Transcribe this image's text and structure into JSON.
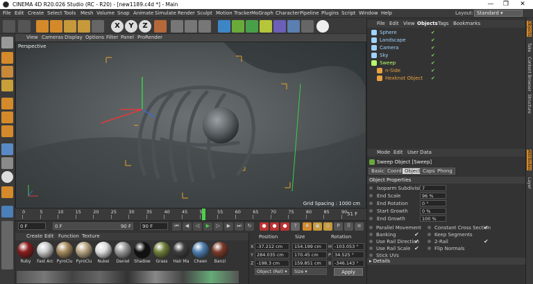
{
  "window": {
    "title": "CINEMA 4D R20.026 Studio (RC - R20) - [new1189.c4d *] - Main",
    "minimize": "—",
    "maximize": "❐",
    "close": "✕"
  },
  "menubar": {
    "items": [
      "File",
      "Edit",
      "Create",
      "Select",
      "Tools",
      "Mesh",
      "Volume",
      "Snap",
      "Animate",
      "Simulate",
      "Render",
      "Sculpt",
      "Motion Tracker",
      "MoGraph",
      "Character",
      "Pipeline",
      "Plugins",
      "Script",
      "Window",
      "Help"
    ],
    "layout_label": "Layout:",
    "layout_value": "Standard"
  },
  "toolbar": {
    "axis_x": "X",
    "axis_y": "Y",
    "axis_z": "Z"
  },
  "viewport": {
    "menu": [
      "View",
      "Cameras",
      "Display",
      "Options",
      "Filter",
      "Panel",
      "ProRender"
    ],
    "label": "Perspective",
    "grid_spacing": "Grid Spacing : 1000 cm"
  },
  "timeline": {
    "ticks": [
      "0",
      "5",
      "10",
      "15",
      "20",
      "25",
      "30",
      "35",
      "40",
      "45",
      "50",
      "55",
      "60",
      "65",
      "70",
      "75",
      "80",
      "85",
      "90"
    ],
    "current_frame": "51 F",
    "playhead_value": 51
  },
  "playback": {
    "start": "0 F",
    "min": "0 F",
    "max": "90 F",
    "end": "90 F"
  },
  "materials": {
    "menu": [
      "Create",
      "Edit",
      "Function",
      "Texture"
    ],
    "items": [
      {
        "name": "Ruby",
        "color": "#8a1d1d"
      },
      {
        "name": "Fast Arc",
        "color": "#c9c9c9"
      },
      {
        "name": "PyroClu",
        "color": "#a58a5e"
      },
      {
        "name": "PyroClu",
        "color": "#b7a482"
      },
      {
        "name": "Nukei",
        "color": "#dddddd"
      },
      {
        "name": "Daniel",
        "color": "#9a9a9a"
      },
      {
        "name": "Shadow",
        "color": "#111111"
      },
      {
        "name": "Grass",
        "color": "#6f7f3a"
      },
      {
        "name": "Hair Ma",
        "color": "#3f3f3f"
      },
      {
        "name": "Cheen",
        "color": "#4f7fb0"
      },
      {
        "name": "Banzi",
        "color": "#7a3a2a"
      }
    ]
  },
  "coordinates": {
    "headers": {
      "position": "Position",
      "size": "Size",
      "rotation": "Rotation"
    },
    "rows": [
      {
        "axis": "X",
        "pos": "-37.212 cm",
        "size": "154.199 cm",
        "rot_axis": "H",
        "rot": "-103.053 °"
      },
      {
        "axis": "Y",
        "pos": "284.035 cm",
        "size": "170.45 cm",
        "rot_axis": "P",
        "rot": "34.525 °"
      },
      {
        "axis": "Z",
        "pos": "-198.3 cm",
        "size": "159.851 cm",
        "rot_axis": "B",
        "rot": "-346.143 °"
      }
    ],
    "mode": "Object (Rel)",
    "size_mode": "Size",
    "apply": "Apply"
  },
  "objects": {
    "menu": [
      "File",
      "Edit",
      "View",
      "Objects",
      "Tags",
      "Bookmarks"
    ],
    "items": [
      {
        "name": "Sphere",
        "indent": 0,
        "color": "#9fd3ff"
      },
      {
        "name": "Landscape",
        "indent": 0,
        "color": "#9fd3ff"
      },
      {
        "name": "Camera",
        "indent": 0,
        "color": "#9fd3ff"
      },
      {
        "name": "Sky",
        "indent": 0,
        "color": "#9fd3ff"
      },
      {
        "name": "Sweep",
        "indent": 0,
        "color": "#b6ff6a"
      },
      {
        "name": "n-Side",
        "indent": 1,
        "color": "#e9a040"
      },
      {
        "name": "Hexknot Object",
        "indent": 1,
        "color": "#e9a040"
      }
    ]
  },
  "attributes": {
    "menu": [
      "Mode",
      "Edit",
      "User Data"
    ],
    "title": "Sweep Object [Sweep]",
    "tabs": [
      "Basic",
      "Coord",
      "Object",
      "Caps",
      "Phong"
    ],
    "active_tab": "Object",
    "section": "Object Properties",
    "fields": [
      {
        "label": "Isoparm Subdivision",
        "value": "7"
      },
      {
        "label": "End Scale",
        "value": "96 %"
      },
      {
        "label": "End Rotation",
        "value": "0 °"
      },
      {
        "label": "Start Growth",
        "value": "0 %"
      },
      {
        "label": "End Growth",
        "value": "100 %"
      }
    ],
    "checks_left": [
      {
        "label": "Parallel Movement",
        "checked": ""
      },
      {
        "label": "Banking",
        "checked": "✔"
      },
      {
        "label": "Use Rail Direction",
        "checked": "✔"
      },
      {
        "label": "Use Rail Scale",
        "checked": "✔"
      },
      {
        "label": "Stick UVs",
        "checked": ""
      }
    ],
    "checks_right": [
      {
        "label": "Constant Cross Section",
        "checked": "✔"
      },
      {
        "label": "Keep Segments",
        "checked": ""
      },
      {
        "label": "2-Rail",
        "checked": "✔"
      },
      {
        "label": "Flip Normals",
        "checked": ""
      }
    ],
    "details": "▸ Details"
  },
  "right_strip": [
    "Objects",
    "Take",
    "Content Browser",
    "Structure",
    "Attributes",
    "Layer"
  ]
}
